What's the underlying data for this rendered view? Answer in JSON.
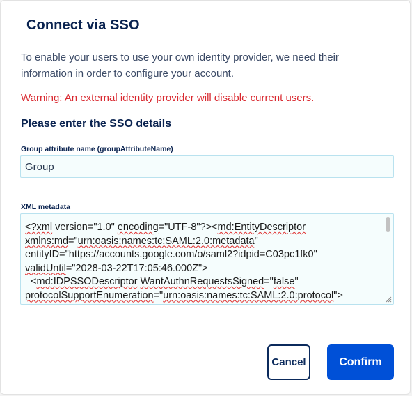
{
  "dialog": {
    "title": "Connect via SSO",
    "intro": "To enable your users to use your own identity provider, we need their information in order to configure your account.",
    "warning": "Warning: An external identity provider will disable current users.",
    "section_title": "Please enter the SSO details"
  },
  "group_field": {
    "label": "Group attribute name (groupAttributeName)",
    "value": "Group"
  },
  "xml_field": {
    "label": "XML metadata",
    "lines": [
      "<?xml version=\"1.0\" encoding=\"UTF-8\"?><md:EntityDescriptor",
      "xmlns:md=\"urn:oasis:names:tc:SAML:2.0:metadata\"",
      "entityID=\"https://accounts.google.com/o/saml2?idpid=C03pc1fk0\"",
      "validUntil=\"2028-03-22T17:05:46.000Z\">",
      "  <md:IDPSSODescriptor WantAuthnRequestsSigned=\"false\"",
      "protocolSupportEnumeration=\"urn:oasis:names:tc:SAML:2.0:protocol\">"
    ]
  },
  "buttons": {
    "cancel": "Cancel",
    "confirm": "Confirm"
  },
  "colors": {
    "title": "#0a2350",
    "warning": "#d9282f",
    "primary": "#0050d7",
    "input_border": "#b9e2ef"
  }
}
